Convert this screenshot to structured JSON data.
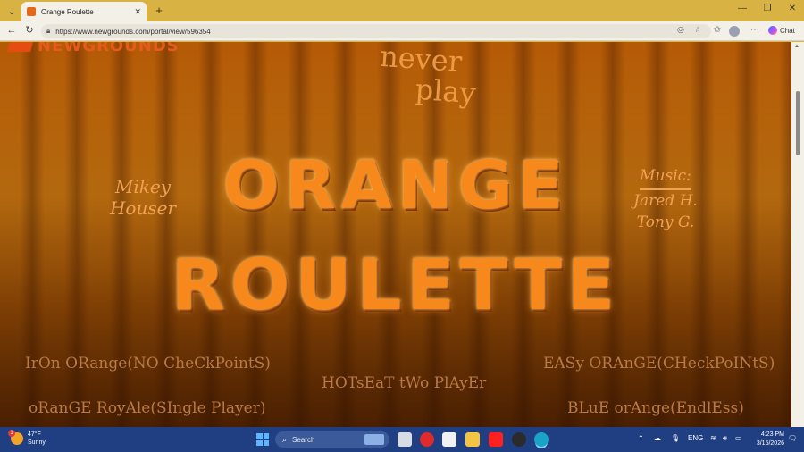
{
  "browser": {
    "tab_title": "Orange Roulette",
    "new_tab_label": "+",
    "url": "https://www.newgrounds.com/portal/view/596354",
    "chat_label": "Chat"
  },
  "game": {
    "site_logo": "NEWGROUNDS",
    "never_play_line1": "never",
    "never_play_line2": "play",
    "title_line1": "ORANGE",
    "title_line2": "ROULETTE",
    "author_line1": "Mikey",
    "author_line2": "Houser",
    "music_label": "Music:",
    "music_credit1": "Jared H.",
    "music_credit2": "Tony G.",
    "menu": {
      "iron": "IrOn ORange(NO CheCkPointS)",
      "easy": "EASy ORAnGE(CHeckPoINtS)",
      "hotseat": "HOTsEaT tWo PlAyEr",
      "royale": "oRanGE RoyAle(SIngle Player)",
      "blue": "BLuE orAnge(EndlEss)"
    }
  },
  "taskbar": {
    "temperature": "47°F",
    "weather": "Sunny",
    "weather_badge": "1",
    "search_label": "Search",
    "language": "ENG",
    "time": "4:23 PM",
    "date": "3/15/2026"
  },
  "colors": {
    "title_bar": "#d8b243",
    "title_orange": "#f7891c",
    "menu_text": "#b97a45",
    "taskbar": "#1f3f82"
  }
}
